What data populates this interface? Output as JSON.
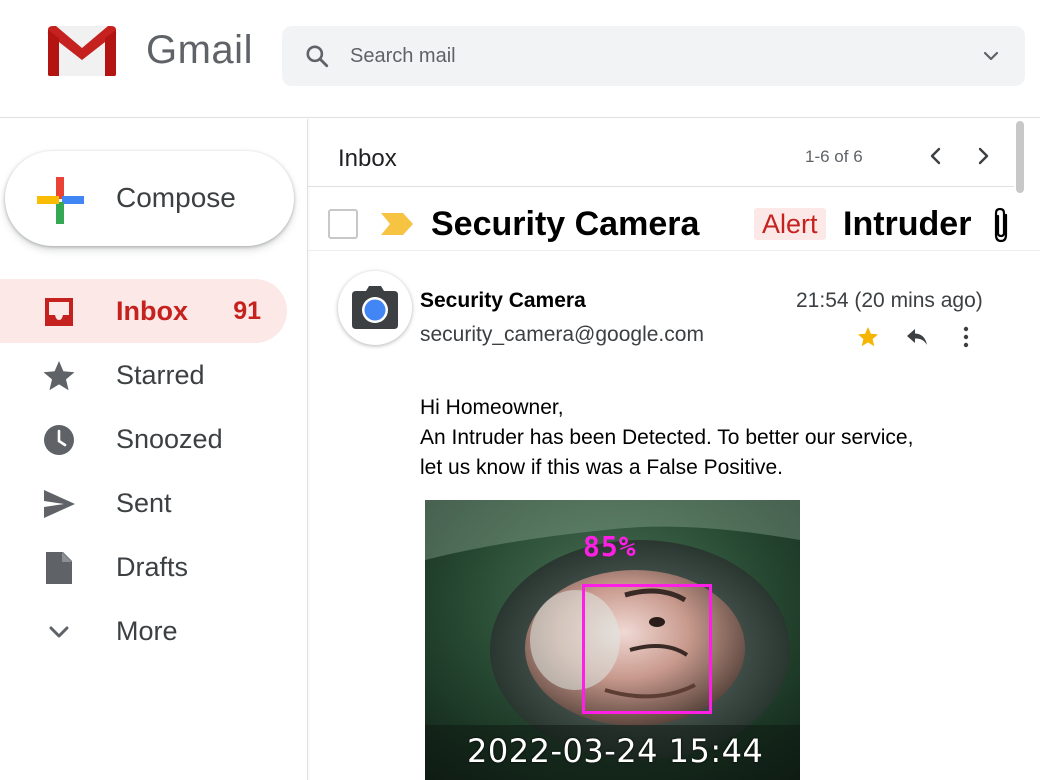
{
  "app": {
    "name": "Gmail"
  },
  "search": {
    "placeholder": "Search mail"
  },
  "compose": {
    "label": "Compose"
  },
  "sidebar": {
    "items": [
      {
        "label": "Inbox",
        "count": "91"
      },
      {
        "label": "Starred"
      },
      {
        "label": "Snoozed"
      },
      {
        "label": "Sent"
      },
      {
        "label": "Drafts"
      },
      {
        "label": "More"
      }
    ]
  },
  "toolbar": {
    "title": "Inbox",
    "count": "1-6 of 6"
  },
  "email": {
    "subject": "Security Camera",
    "label": "Alert",
    "subject_continued": "Intruder",
    "sender_name": "Security Camera",
    "sender_email": "security_camera@google.com",
    "time": "21:54 (20 mins ago)",
    "body": [
      "Hi Homeowner,",
      "An Intruder has been Detected. To better our service,",
      "let us know if this was a False Positive."
    ],
    "image": {
      "confidence": "85%",
      "timestamp": "2022-03-24 15:44"
    }
  },
  "colors": {
    "accent_red": "#c5221f",
    "active_bg": "#fce8e6",
    "important_marker": "#f6c343",
    "detection_box": "#ff1ee6",
    "star": "#f4b400"
  },
  "icons": {
    "logo": "gmail-logo",
    "search": "search-icon",
    "dropdown": "chevron-down-icon",
    "compose": "plus-icon",
    "inbox": "inbox-icon",
    "starred": "star-icon",
    "snoozed": "clock-icon",
    "sent": "send-icon",
    "drafts": "draft-icon",
    "more": "chevron-down-icon",
    "attachment": "paperclip-icon",
    "avatar": "camera-icon"
  }
}
